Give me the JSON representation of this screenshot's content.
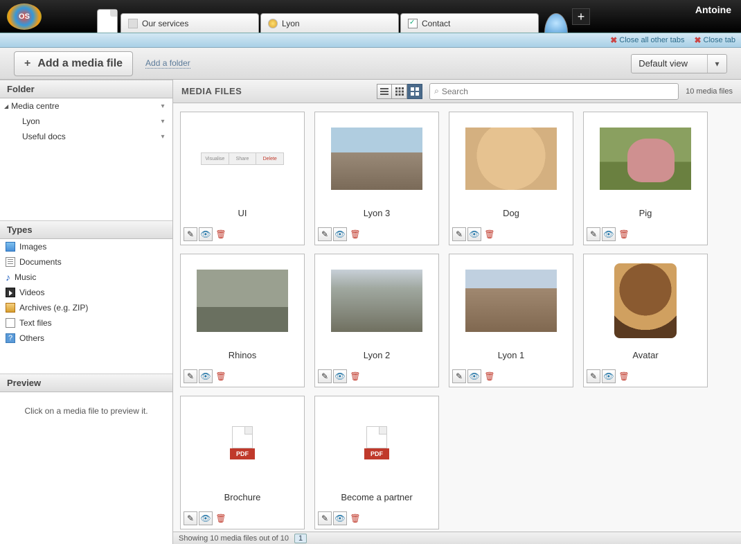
{
  "user": "Antoine",
  "logo_text": "OS",
  "top_tabs": [
    {
      "label": "Our services",
      "icon": "blank"
    },
    {
      "label": "Lyon",
      "icon": "world"
    },
    {
      "label": "Contact",
      "icon": "check"
    }
  ],
  "bluebar": {
    "close_other": "Close all other tabs",
    "close_tab": "Close tab"
  },
  "toolbar": {
    "add_media": "Add a media file",
    "add_folder": "Add a folder",
    "view_label": "Default view"
  },
  "panels": {
    "folder": "Folder",
    "types": "Types",
    "preview": "Preview"
  },
  "tree": {
    "root": "Media centre",
    "children": [
      "Lyon",
      "Useful docs"
    ]
  },
  "types": [
    "Images",
    "Documents",
    "Music",
    "Videos",
    "Archives (e.g. ZIP)",
    "Text files",
    "Others"
  ],
  "preview_msg": "Click on a media file to preview it.",
  "content": {
    "title": "MEDIA FILES",
    "search_placeholder": "Search",
    "count_text": "10 media files"
  },
  "items": [
    {
      "name": "UI",
      "kind": "ui"
    },
    {
      "name": "Lyon 3",
      "kind": "lyon3"
    },
    {
      "name": "Dog",
      "kind": "dog"
    },
    {
      "name": "Pig",
      "kind": "pig"
    },
    {
      "name": "Rhinos",
      "kind": "rhino"
    },
    {
      "name": "Lyon 2",
      "kind": "lyon2"
    },
    {
      "name": "Lyon 1",
      "kind": "lyon1"
    },
    {
      "name": "Avatar",
      "kind": "avatar"
    },
    {
      "name": "Brochure",
      "kind": "pdf"
    },
    {
      "name": "Become a partner",
      "kind": "pdf"
    }
  ],
  "footer": {
    "text": "Showing 10 media files out of 10",
    "page": "1"
  },
  "pdf_label": "PDF",
  "ui_btns": [
    "Visualise",
    "Share",
    "Delete"
  ]
}
